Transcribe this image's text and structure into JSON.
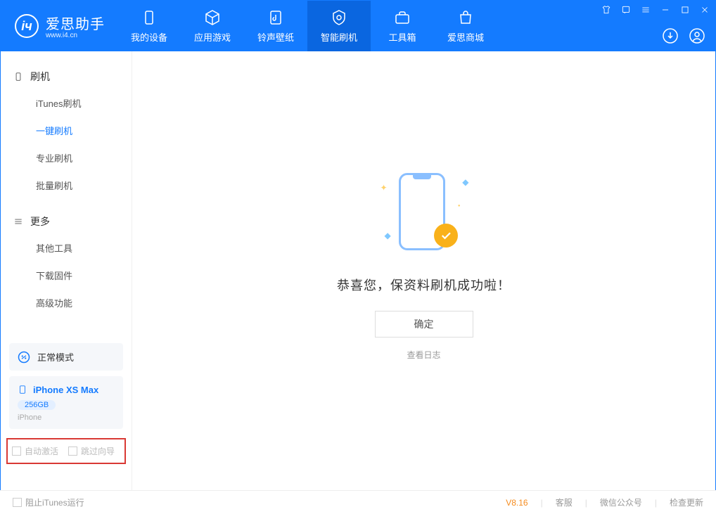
{
  "app": {
    "name": "爱思助手",
    "domain": "www.i4.cn"
  },
  "nav": {
    "tabs": [
      {
        "label": "我的设备"
      },
      {
        "label": "应用游戏"
      },
      {
        "label": "铃声壁纸"
      },
      {
        "label": "智能刷机"
      },
      {
        "label": "工具箱"
      },
      {
        "label": "爱思商城"
      }
    ]
  },
  "sidebar": {
    "group1_title": "刷机",
    "group1_items": [
      "iTunes刷机",
      "一键刷机",
      "专业刷机",
      "批量刷机"
    ],
    "group2_title": "更多",
    "group2_items": [
      "其他工具",
      "下载固件",
      "高级功能"
    ]
  },
  "status": {
    "mode_label": "正常模式"
  },
  "device": {
    "name": "iPhone XS Max",
    "capacity": "256GB",
    "type": "iPhone"
  },
  "options": {
    "auto_activate": "自动激活",
    "skip_guide": "跳过向导"
  },
  "main": {
    "success_message": "恭喜您，保资料刷机成功啦！",
    "ok_button": "确定",
    "view_log": "查看日志"
  },
  "footer": {
    "block_itunes": "阻止iTunes运行",
    "version": "V8.16",
    "links": [
      "客服",
      "微信公众号",
      "检查更新"
    ]
  }
}
